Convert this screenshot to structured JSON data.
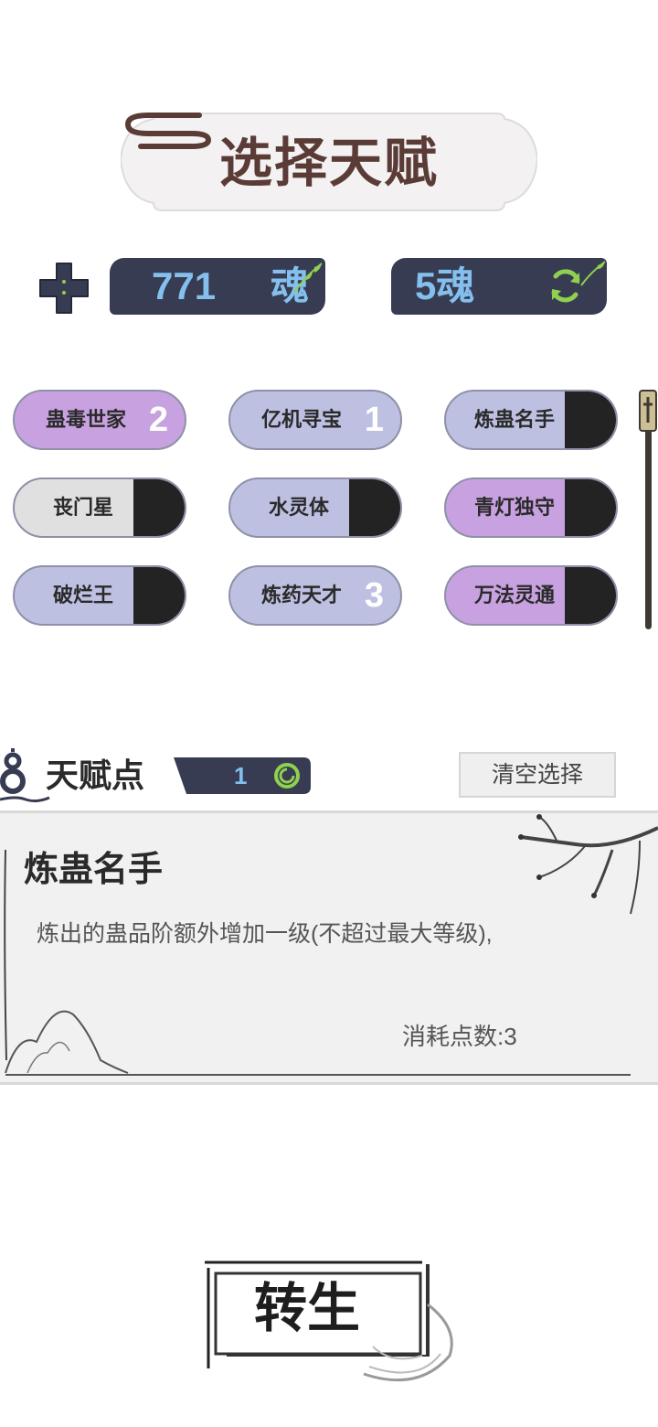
{
  "header": {
    "title": "选择天赋"
  },
  "currency": {
    "soul_amount": "771",
    "soul_unit": "魂",
    "refresh_cost": "5魂"
  },
  "talents": [
    {
      "label": "蛊毒世家",
      "count": "2",
      "style": "purple"
    },
    {
      "label": "亿机寻宝",
      "count": "1",
      "style": "lavender"
    },
    {
      "label": "炼蛊名手",
      "count": "",
      "style": "lavender"
    },
    {
      "label": "丧门星",
      "count": "",
      "style": "gray"
    },
    {
      "label": "水灵体",
      "count": "",
      "style": "lavender"
    },
    {
      "label": "青灯独守",
      "count": "",
      "style": "purple"
    },
    {
      "label": "破烂王",
      "count": "",
      "style": "lavender"
    },
    {
      "label": "炼药天才",
      "count": "3",
      "style": "lavender"
    },
    {
      "label": "万法灵通",
      "count": "",
      "style": "purple"
    }
  ],
  "talent_points": {
    "label": "天赋点",
    "value": "1",
    "clear_label": "清空选择"
  },
  "detail": {
    "name": "炼蛊名手",
    "description": "炼出的蛊品阶额外增加一级(不超过最大等级),",
    "cost": "消耗点数:3"
  },
  "actions": {
    "rebirth_label": "转生"
  },
  "colors": {
    "purple": "#c8a2e0",
    "lavender": "#bec0e2",
    "gray": "#e0e0e0",
    "bar_dark": "#383c52",
    "accent_blue": "#84c0ee",
    "accent_green": "#8fd14f"
  }
}
